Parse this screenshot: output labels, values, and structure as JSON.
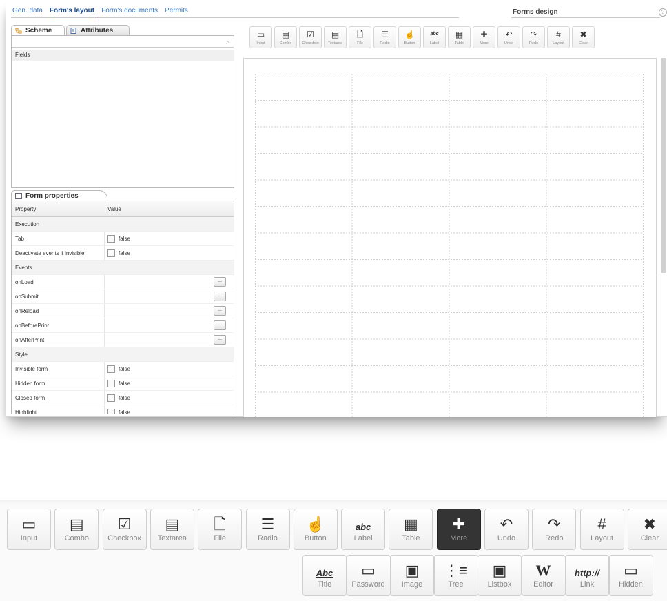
{
  "nav": {
    "tabs": [
      "Gen. data",
      "Form's layout",
      "Form's documents",
      "Permits"
    ],
    "active": "Form's layout",
    "design_title": "Forms design"
  },
  "left_tabs": {
    "scheme": "Scheme",
    "attributes": "Attributes"
  },
  "fields_label": "Fields",
  "props_tab": "Form properties",
  "props_headers": {
    "property": "Property",
    "value": "Value"
  },
  "properties": [
    {
      "name": "Execution",
      "section": true
    },
    {
      "name": "Tab",
      "value": "false",
      "type": "checkbox"
    },
    {
      "name": "Deactivate events if invisible",
      "value": "false",
      "type": "checkbox"
    },
    {
      "name": "Events",
      "section": true
    },
    {
      "name": "onLoad",
      "type": "button",
      "btn": "..."
    },
    {
      "name": "onSubmit",
      "type": "button",
      "btn": "..."
    },
    {
      "name": "onReload",
      "type": "button",
      "btn": "..."
    },
    {
      "name": "onBeforePrint",
      "type": "button",
      "btn": "..."
    },
    {
      "name": "onAfterPrint",
      "type": "button",
      "btn": "..."
    },
    {
      "name": "Style",
      "section": true
    },
    {
      "name": "Invisible form",
      "value": "false",
      "type": "checkbox"
    },
    {
      "name": "Hidden form",
      "value": "false",
      "type": "checkbox"
    },
    {
      "name": "Closed form",
      "value": "false",
      "type": "checkbox"
    },
    {
      "name": "Highlight",
      "value": "false",
      "type": "checkbox"
    }
  ],
  "toolbar_small": [
    {
      "label": "Input",
      "icon": "input-icon"
    },
    {
      "label": "Combo",
      "icon": "combo-icon"
    },
    {
      "label": "Checkbox",
      "icon": "checkbox-icon"
    },
    {
      "label": "Textarea",
      "icon": "textarea-icon"
    },
    {
      "label": "File",
      "icon": "file-icon"
    },
    {
      "label": "Radio",
      "icon": "radio-icon"
    },
    {
      "label": "Button",
      "icon": "button-icon"
    },
    {
      "label": "Label",
      "icon": "label-icon"
    },
    {
      "label": "Table",
      "icon": "table-icon"
    },
    {
      "label": "More",
      "icon": "plus-icon"
    },
    {
      "label": "Undo",
      "icon": "undo-icon"
    },
    {
      "label": "Redo",
      "icon": "redo-icon"
    },
    {
      "label": "Layout",
      "icon": "hash-icon"
    },
    {
      "label": "Clear",
      "icon": "clear-icon"
    }
  ],
  "toolbar_big_row1": [
    {
      "label": "Input",
      "icon": "input-icon"
    },
    {
      "label": "Combo",
      "icon": "combo-icon"
    },
    {
      "label": "Checkbox",
      "icon": "checkbox-icon"
    },
    {
      "label": "Textarea",
      "icon": "textarea-icon"
    },
    {
      "label": "File",
      "icon": "file-icon"
    },
    {
      "label": "Radio",
      "icon": "radio-icon"
    },
    {
      "label": "Button",
      "icon": "button-icon"
    },
    {
      "label": "Label",
      "icon": "label-icon"
    },
    {
      "label": "Table",
      "icon": "table-icon"
    },
    {
      "label": "More",
      "icon": "plus-icon",
      "active": true
    },
    {
      "label": "Undo",
      "icon": "undo-icon"
    },
    {
      "label": "Redo",
      "icon": "redo-icon"
    },
    {
      "label": "Layout",
      "icon": "hash-icon"
    },
    {
      "label": "Clear",
      "icon": "clear-icon"
    }
  ],
  "toolbar_big_row2": [
    {
      "label": "Title",
      "icon": "title-icon"
    },
    {
      "label": "Password",
      "icon": "password-icon"
    },
    {
      "label": "Image",
      "icon": "image-icon"
    },
    {
      "label": "Tree",
      "icon": "tree-icon"
    },
    {
      "label": "Listbox",
      "icon": "listbox-icon"
    },
    {
      "label": "Editor",
      "icon": "editor-icon"
    },
    {
      "label": "Link",
      "icon": "link-icon"
    },
    {
      "label": "Hidden",
      "icon": "hidden-icon"
    }
  ],
  "glyphs": {
    "input-icon": "▭",
    "combo-icon": "▤",
    "checkbox-icon": "☑",
    "textarea-icon": "▤",
    "file-icon": "🗋",
    "radio-icon": "☰",
    "button-icon": "☝",
    "label-icon": "abc",
    "table-icon": "▦",
    "plus-icon": "✚",
    "undo-icon": "↶",
    "redo-icon": "↷",
    "hash-icon": "#",
    "clear-icon": "✖",
    "title-icon": "Abc",
    "password-icon": "▭",
    "image-icon": "▣",
    "tree-icon": "⋮≡",
    "listbox-icon": "▣",
    "editor-icon": "W",
    "link-icon": "http://",
    "hidden-icon": "▭"
  }
}
